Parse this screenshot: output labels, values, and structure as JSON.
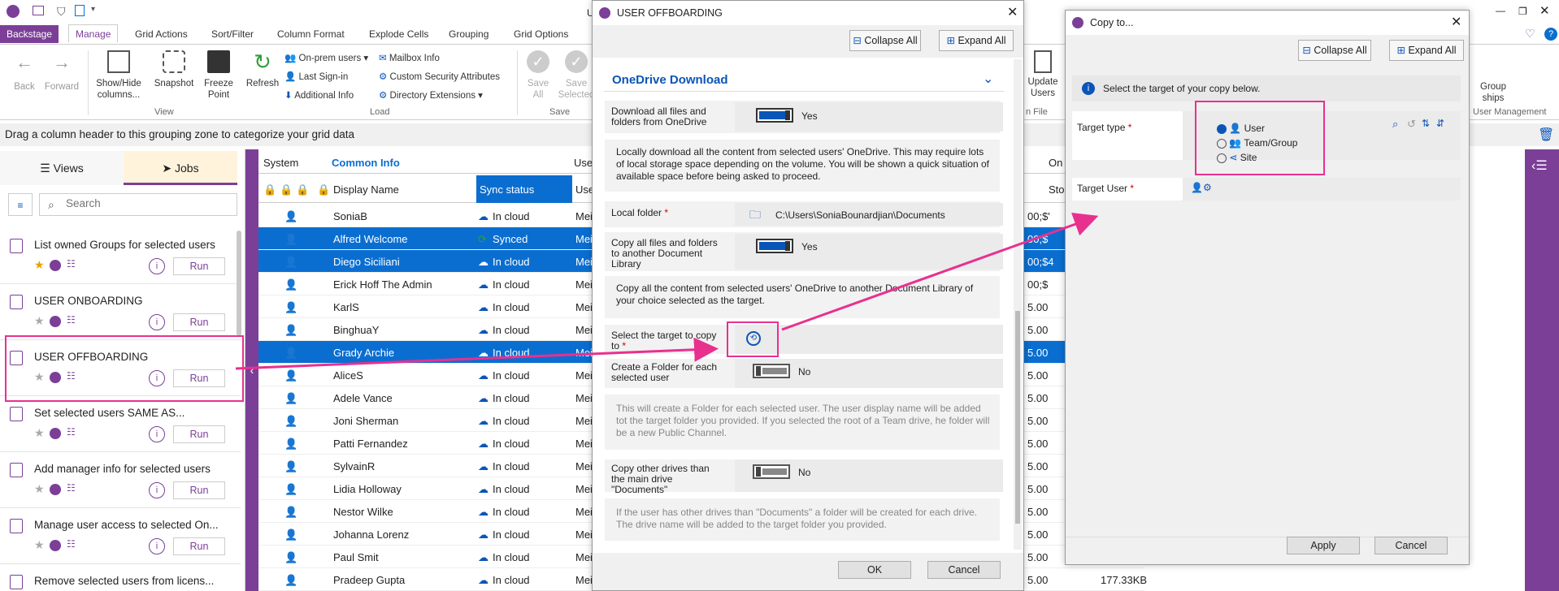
{
  "qat": {
    "title_partial": "U"
  },
  "ribbon": {
    "tabs": [
      "Backstage",
      "Manage",
      "Grid Actions",
      "Sort/Filter",
      "Column Format",
      "Explode Cells",
      "Grouping",
      "Grid Options"
    ],
    "back": "Back",
    "forward": "Forward",
    "showhide": "Show/Hide columns...",
    "snapshot": "Snapshot",
    "freeze": "Freeze Point",
    "refresh": "Refresh",
    "onprem": "On-prem users",
    "lastsignin": "Last Sign-in",
    "additional": "Additional Info",
    "mailbox": "Mailbox Info",
    "customsec": "Custom Security Attributes",
    "dirext": "Directory Extensions",
    "saveall": "Save All",
    "saveselected": "Save Selected",
    "group_view": "View",
    "group_load": "Load",
    "group_save": "Save",
    "update_users": "Update Users",
    "in_file": "n File",
    "group_ships": "Group ships",
    "user_mgmt": "User Management"
  },
  "grouping_zone": "Drag a column header to this grouping zone to categorize your grid data",
  "left": {
    "views": "Views",
    "jobs": "Jobs",
    "search_placeholder": "Search",
    "jobs_list": [
      {
        "title": "List owned Groups for selected users",
        "run": "Run"
      },
      {
        "title": "USER ONBOARDING",
        "run": "Run"
      },
      {
        "title": "USER OFFBOARDING",
        "run": "Run"
      },
      {
        "title": "Set selected users SAME AS...",
        "run": "Run"
      },
      {
        "title": "Add manager info for selected users",
        "run": "Run"
      },
      {
        "title": "Manage user access to selected On...",
        "run": "Run"
      },
      {
        "title": "Remove selected users from licens...",
        "run": ""
      }
    ]
  },
  "grid": {
    "header_system": "System",
    "header_common": "Common Info",
    "header_use": "Use",
    "header_on": "On",
    "col_display": "Display Name",
    "col_sync": "Sync status",
    "col_use": "Use",
    "col_sto": "Sto",
    "rows": [
      {
        "name": "SoniaB",
        "sync": "In cloud",
        "use": "Mei",
        "right": "00;$'"
      },
      {
        "name": "Alfred Welcome",
        "sync": "Synced",
        "use": "Mei",
        "right": "00;$"
      },
      {
        "name": "Diego Siciliani",
        "sync": "In cloud",
        "use": "Mei",
        "right": "00;$4"
      },
      {
        "name": "Erick Hoff The Admin",
        "sync": "In cloud",
        "use": "Mei",
        "right": "00;$"
      },
      {
        "name": "KarlS",
        "sync": "In cloud",
        "use": "Mei",
        "right": "5.00"
      },
      {
        "name": "BinghuaY",
        "sync": "In cloud",
        "use": "Mei",
        "right": "5.00"
      },
      {
        "name": "Grady Archie",
        "sync": "In cloud",
        "use": "Mei",
        "right": "5.00"
      },
      {
        "name": "AliceS",
        "sync": "In cloud",
        "use": "Mei",
        "right": "5.00"
      },
      {
        "name": "Adele Vance",
        "sync": "In cloud",
        "use": "Mei",
        "right": "5.00"
      },
      {
        "name": "Joni Sherman",
        "sync": "In cloud",
        "use": "Mei",
        "right": "5.00"
      },
      {
        "name": "Patti Fernandez",
        "sync": "In cloud",
        "use": "Mei",
        "right": "5.00"
      },
      {
        "name": "SylvainR",
        "sync": "In cloud",
        "use": "Mei",
        "right": "5.00"
      },
      {
        "name": "Lidia Holloway",
        "sync": "In cloud",
        "use": "Mei",
        "right": "5.00"
      },
      {
        "name": "Nestor Wilke",
        "sync": "In cloud",
        "use": "Mei",
        "right": "5.00"
      },
      {
        "name": "Johanna Lorenz",
        "sync": "In cloud",
        "use": "Mei",
        "right": "5.00"
      },
      {
        "name": "Paul Smit",
        "sync": "In cloud",
        "use": "Mei",
        "right": "5.00"
      },
      {
        "name": "Pradeep Gupta",
        "sync": "In cloud",
        "use": "Mei",
        "right": "5.00",
        "size": "177.33KB"
      }
    ]
  },
  "offboarding": {
    "title": "USER OFFBOARDING",
    "collapse": "Collapse All",
    "expand": "Expand All",
    "section": "OneDrive Download",
    "dl_label": "Download all files and folders from OneDrive",
    "dl_value": "Yes",
    "dl_desc": "Locally download all the content from selected users' OneDrive. This may require lots of local storage space depending on the volume. You will be shown a quick situation of available space before being asked to proceed.",
    "local_label": "Local folder",
    "local_value": "C:\\Users\\SoniaBounardjian\\Documents",
    "copy_label": "Copy all files and folders to another Document Library",
    "copy_value": "Yes",
    "copy_desc": "Copy all the content from selected users' OneDrive to another Document Library of your choice selected as the target.",
    "target_label": "Select the target to copy to",
    "folder_label": "Create a Folder for each selected user",
    "folder_value": "No",
    "folder_desc": "This will create a Folder for each selected user. The user display name will be added tot the target folder you provided. If you selected the root of a Team drive, he folder will be a new Public Channel.",
    "other_label": "Copy other drives than the main drive \"Documents\"",
    "other_value": "No",
    "other_desc": "If the user has other drives than \"Documents\" a folder will be created for each drive. The drive name will be added to the target folder you provided.",
    "ok": "OK",
    "cancel": "Cancel"
  },
  "copyto": {
    "title": "Copy to...",
    "collapse": "Collapse All",
    "expand": "Expand All",
    "info": "Select the target of your copy below.",
    "target_type": "Target type",
    "opt_user": "User",
    "opt_team": "Team/Group",
    "opt_site": "Site",
    "target_user": "Target User",
    "apply": "Apply",
    "cancel": "Cancel"
  },
  "colors": {
    "accent": "#7b3f98",
    "select": "#0a6ed1",
    "highlight": "#e8308f"
  }
}
